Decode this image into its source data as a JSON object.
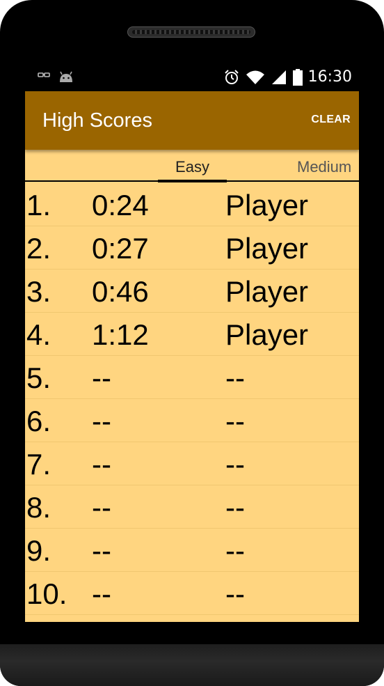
{
  "status_bar": {
    "clock": "16:30",
    "left_icons": [
      "glasses-icon",
      "android-icon"
    ],
    "right_icons": [
      "alarm-icon",
      "wifi-icon",
      "signal-icon",
      "battery-icon"
    ]
  },
  "action_bar": {
    "title": "High Scores",
    "clear_label": "CLEAR",
    "color": "#9a6500"
  },
  "tabs": [
    {
      "label": "Easy",
      "selected": true
    },
    {
      "label": "Medium",
      "selected": false
    }
  ],
  "scores": [
    {
      "rank": "1.",
      "time": "0:24",
      "player": "Player"
    },
    {
      "rank": "2.",
      "time": "0:27",
      "player": "Player"
    },
    {
      "rank": "3.",
      "time": "0:46",
      "player": "Player"
    },
    {
      "rank": "4.",
      "time": "1:12",
      "player": "Player"
    },
    {
      "rank": "5.",
      "time": "--",
      "player": "--"
    },
    {
      "rank": "6.",
      "time": "--",
      "player": "--"
    },
    {
      "rank": "7.",
      "time": "--",
      "player": "--"
    },
    {
      "rank": "8.",
      "time": "--",
      "player": "--"
    },
    {
      "rank": "9.",
      "time": "--",
      "player": "--"
    },
    {
      "rank": "10.",
      "time": "--",
      "player": "--"
    }
  ],
  "colors": {
    "background": "#ffd580",
    "action_bar": "#9a6500",
    "text": "#000000"
  }
}
